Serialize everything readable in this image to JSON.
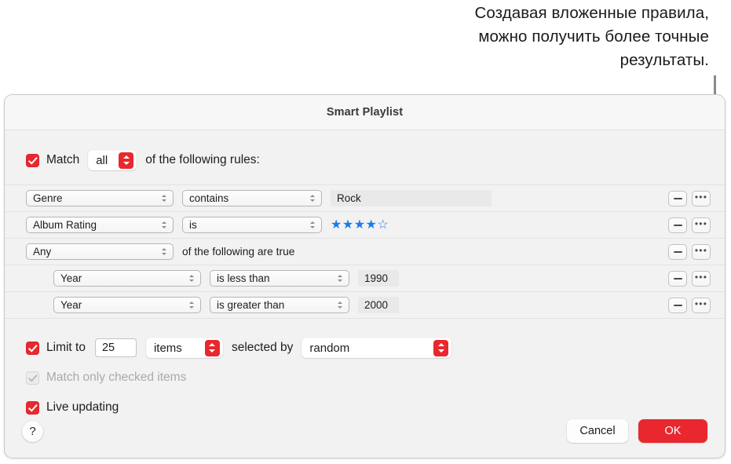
{
  "callout": {
    "lines": [
      "Создавая вложенные правила,",
      "можно получить более точные",
      "результаты."
    ],
    "text": "Создавая вложенные правила, можно получить более точные результаты."
  },
  "dialog": {
    "title": "Smart Playlist",
    "match": {
      "checked": true,
      "label": "Match",
      "selector_value": "all",
      "trailing_label": "of the following rules:"
    },
    "rules": [
      {
        "nested": false,
        "field": "Genre",
        "operator": "contains",
        "value_type": "text",
        "value": "Rock",
        "remove_label": "—",
        "more_label": "•••"
      },
      {
        "nested": false,
        "field": "Album Rating",
        "operator": "is",
        "value_type": "stars",
        "value": "★★★★☆",
        "stars_filled": 4,
        "stars_total": 5,
        "remove_label": "—",
        "more_label": "•••"
      },
      {
        "nested": false,
        "group": true,
        "field": "Any",
        "group_text": "of the following are true",
        "remove_label": "—",
        "more_label": "•••"
      },
      {
        "nested": true,
        "field": "Year",
        "operator": "is less than",
        "value_type": "number",
        "value": "1990",
        "remove_label": "—",
        "more_label": "•••"
      },
      {
        "nested": true,
        "field": "Year",
        "operator": "is greater than",
        "value_type": "number",
        "value": "2000",
        "remove_label": "—",
        "more_label": "•••"
      }
    ],
    "options": {
      "limit": {
        "checked": true,
        "label": "Limit to",
        "amount": "25",
        "unit": "items",
        "selected_by_label": "selected by",
        "selected_by_value": "random"
      },
      "match_only_checked": {
        "checked": true,
        "enabled": false,
        "label": "Match only checked items"
      },
      "live_updating": {
        "checked": true,
        "label": "Live updating"
      }
    },
    "footer": {
      "help_label": "?",
      "cancel_label": "Cancel",
      "ok_label": "OK"
    }
  },
  "colors": {
    "accent_red": "#e8282e",
    "star_blue": "#1a7ced",
    "dialog_bg": "#f2f2f2",
    "titlebar_bg": "#f7f7f7",
    "callout_gray": "#8a8a8a"
  }
}
